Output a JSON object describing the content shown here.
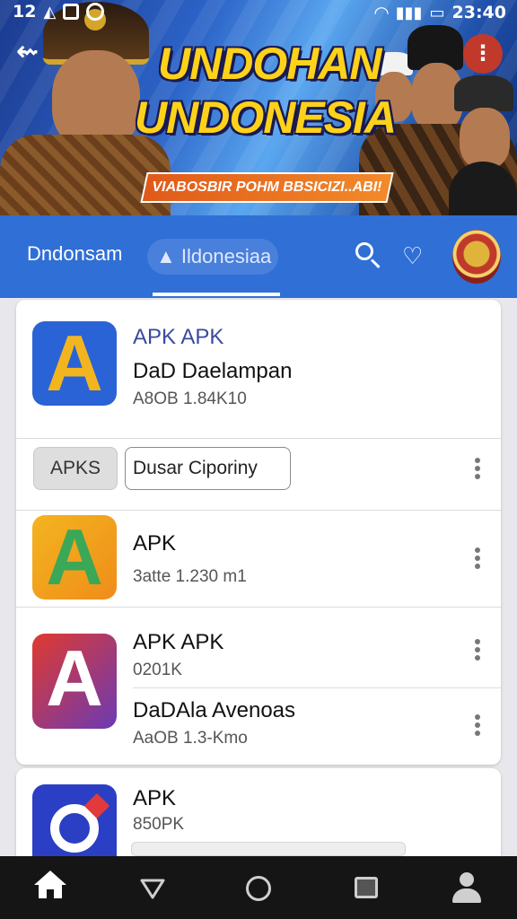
{
  "status_bar": {
    "left_text": "12",
    "time": "23:40"
  },
  "banner": {
    "title_line1": "UNDOHAN",
    "title_line2": "UNDONESIA",
    "ribbon": "VIABOSBIR POHM BBSICIZI..ABI!"
  },
  "app_bar": {
    "name": "Dndonsam",
    "search_text": "Ildonesiaa",
    "icons": [
      "search-icon",
      "notification-heart-icon",
      "garuda-emblem-icon"
    ]
  },
  "list": {
    "featured": {
      "title": "APK APK",
      "name": "DaD Daelampan",
      "meta": "A8OB 1.84K10"
    },
    "chips": [
      "APKS",
      "Dusar Ciporiny"
    ],
    "items": [
      {
        "title": "APK",
        "meta": "3atte 1.230 m1",
        "icon_colors": [
          "#f3b51f",
          "#3aa856"
        ]
      },
      {
        "title": "APK APK",
        "meta": "0201K",
        "icon_colors": [
          "#e03a2f",
          "#6b3ab4"
        ]
      },
      {
        "title": "DaDAla Avenoas",
        "meta": "AaOB 1.3-Kmo",
        "icon_colors": []
      },
      {
        "title": "APK",
        "meta": "850PK",
        "icon_colors": [
          "#2b3fc4",
          "#ffffff"
        ]
      }
    ]
  },
  "nav": [
    "home-icon",
    "back-icon",
    "home-circle-icon",
    "recents-icon",
    "profile-icon"
  ],
  "colors": {
    "accent": "#2f6fd6",
    "banner_title": "#ffd21a",
    "nav_bg": "#151515"
  }
}
